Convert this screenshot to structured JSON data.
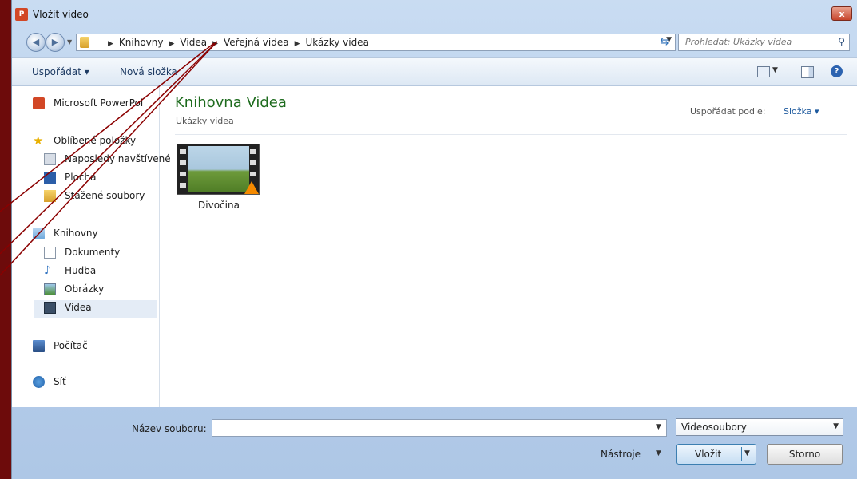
{
  "window": {
    "title": "Vložit video",
    "close_label": "x"
  },
  "address": {
    "crumbs": [
      "Knihovny",
      "Videa",
      "Veřejná videa",
      "Ukázky videa"
    ],
    "separator": "▶"
  },
  "search": {
    "placeholder": "Prohledat: Ukázky videa"
  },
  "toolbar": {
    "organize": "Uspořádat ▾",
    "new_folder": "Nová složka"
  },
  "sidebar": {
    "powerpoint": "Microsoft PowerPoi",
    "favorites": "Oblíbené položky",
    "recent": "Naposledy navštívené",
    "desktop": "Plocha",
    "downloads": "Stažené soubory",
    "libraries": "Knihovny",
    "documents": "Dokumenty",
    "music": "Hudba",
    "pictures": "Obrázky",
    "videos": "Videa",
    "computer": "Počítač",
    "network": "Síť"
  },
  "main": {
    "library_title": "Knihovna Videa",
    "library_subtitle": "Ukázky videa",
    "arrange_label": "Uspořádat podle:",
    "arrange_value": "Složka ▾",
    "files": [
      {
        "name": "Divočina"
      }
    ]
  },
  "footer": {
    "filename_label": "Název souboru:",
    "filename_value": "",
    "filetype": "Videosoubory",
    "tools": "Nástroje",
    "insert": "Vložit",
    "cancel": "Storno"
  },
  "colors": {
    "library_title": "#1d6b1d",
    "background": "#6d0b0b",
    "annotation_line": "#8b0000"
  }
}
